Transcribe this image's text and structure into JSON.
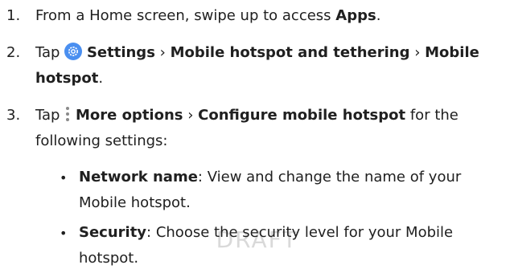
{
  "watermark": "DRAFT",
  "steps": [
    {
      "number": "1.",
      "pre": "From a Home screen, swipe up to access ",
      "bold": "Apps",
      "post": "."
    },
    {
      "number": "2.",
      "pre": "Tap ",
      "icon": "settings-gear-icon",
      "b1": "Settings",
      "sep1": " › ",
      "b2": "Mobile hotspot and tethering",
      "sep2": " › ",
      "b3": "Mobile hotspot",
      "post": "."
    },
    {
      "number": "3.",
      "pre": "Tap ",
      "icon": "more-options-icon",
      "b1": "More options",
      "sep1": " › ",
      "b2": "Configure mobile hotspot",
      "post": " for the following settings:"
    }
  ],
  "bullets": [
    {
      "bullet": "•",
      "term": "Network name",
      "desc": ": View and change the name of your Mobile hotspot."
    },
    {
      "bullet": "•",
      "term": "Security",
      "desc": ": Choose the security level for your Mobile hotspot."
    }
  ],
  "colors": {
    "text": "#202020",
    "settings_icon": "#4a8ff0",
    "watermark": "#d9d9d9"
  }
}
